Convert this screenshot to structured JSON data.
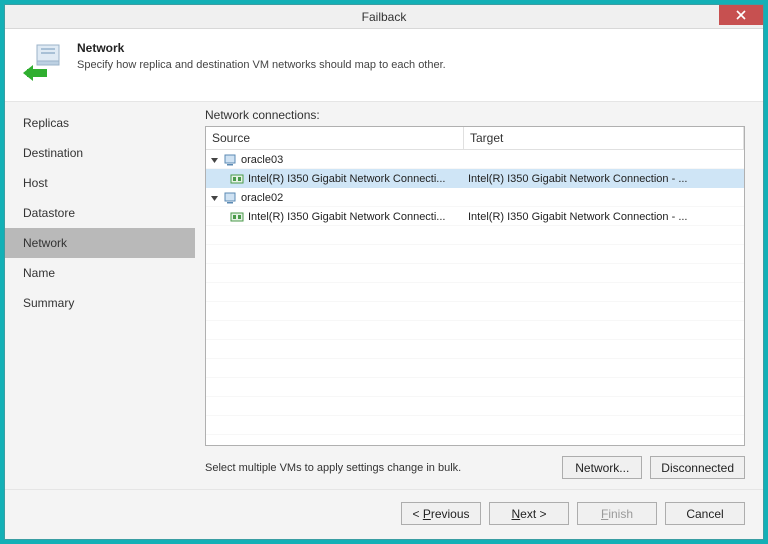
{
  "window": {
    "title": "Failback"
  },
  "header": {
    "title": "Network",
    "desc": "Specify how replica and destination VM networks should map to each other."
  },
  "sidebar": {
    "items": [
      {
        "label": "Replicas"
      },
      {
        "label": "Destination"
      },
      {
        "label": "Host"
      },
      {
        "label": "Datastore"
      },
      {
        "label": "Network"
      },
      {
        "label": "Name"
      },
      {
        "label": "Summary"
      }
    ],
    "activeIndex": 4
  },
  "content": {
    "connLabel": "Network connections:",
    "columns": {
      "source": "Source",
      "target": "Target"
    },
    "rows": [
      {
        "kind": "group",
        "caret": true,
        "icon": "vm",
        "source": "oracle03",
        "target": ""
      },
      {
        "kind": "nic",
        "icon": "nic",
        "source": "Intel(R) I350 Gigabit Network Connecti...",
        "target": "Intel(R) I350 Gigabit Network Connection - ...",
        "selected": true
      },
      {
        "kind": "group",
        "caret": true,
        "icon": "vm",
        "source": "oracle02",
        "target": ""
      },
      {
        "kind": "nic",
        "icon": "nic",
        "source": "Intel(R) I350 Gigabit Network Connecti...",
        "target": "Intel(R) I350 Gigabit Network Connection - ..."
      }
    ],
    "hint": "Select multiple VMs to apply settings change in bulk.",
    "networkBtn": "Network...",
    "disconnectedBtn": "Disconnected"
  },
  "footer": {
    "previous": "< Previous",
    "next": "Next >",
    "finish": "Finish",
    "cancel": "Cancel",
    "prevKey": "P",
    "nextKey": "N",
    "finishKey": "F"
  }
}
